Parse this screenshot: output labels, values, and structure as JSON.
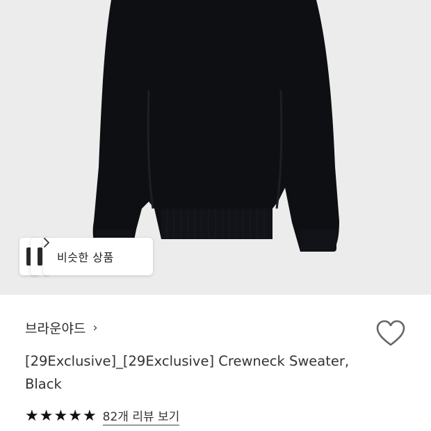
{
  "product_image": {
    "background_color": "#ececec",
    "garment_color": "#0d0f12"
  },
  "similar_products": {
    "label": "비슷한 상품",
    "chevron_icon": "chevron-right-icon"
  },
  "brand": {
    "name": "브라운야드",
    "chevron": "›"
  },
  "wishlist": {
    "icon": "heart-outline-icon"
  },
  "product": {
    "title": "[29Exclusive]_[29Exclusive] Crewneck Sweater, Black"
  },
  "rating": {
    "stars": [
      "★",
      "★",
      "★",
      "★",
      "★"
    ],
    "star_color": "#111111",
    "review_link": "82개 리뷰 보기"
  }
}
